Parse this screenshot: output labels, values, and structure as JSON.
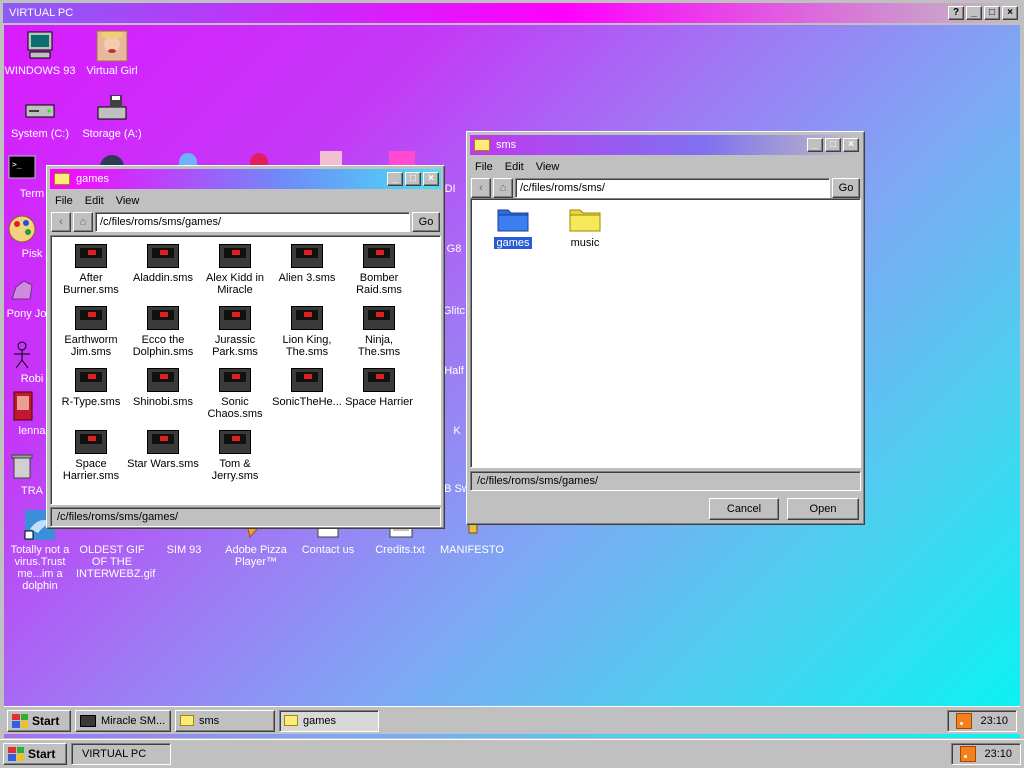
{
  "outer_window": {
    "title": "VIRTUAL PC",
    "buttons": [
      "?",
      "_",
      "□",
      "×"
    ]
  },
  "desktop_icons": [
    {
      "label": "WINDOWS 93",
      "icon": "computer-icon"
    },
    {
      "label": "Virtual Girl",
      "icon": "face-icon"
    },
    {
      "label": "System (C:)",
      "icon": "drive-icon"
    },
    {
      "label": "Storage (A:)",
      "icon": "floppy-drive-icon"
    },
    {
      "label": "Term",
      "icon": "terminal-icon"
    },
    {
      "label": "Pisk",
      "icon": "paint-icon"
    },
    {
      "label": "Pony Jock",
      "icon": "pony-icon"
    },
    {
      "label": "Robi",
      "icon": "robot-icon"
    },
    {
      "label": "lenna",
      "icon": "image-icon"
    },
    {
      "label": "TRA",
      "icon": "trash-icon"
    },
    {
      "label": "Totally not a virus.Trust me...im a dolphin",
      "icon": "dolphin-icon"
    },
    {
      "label": "OLDEST GIF OF THE INTERWEBZ.gif",
      "icon": "gif-icon"
    },
    {
      "label": "SIM 93",
      "icon": "sim-icon"
    },
    {
      "label": "Adobe Pizza Player™",
      "icon": "pizza-icon"
    },
    {
      "label": "Contact us",
      "icon": "contact-icon"
    },
    {
      "label": "Credits.txt",
      "icon": "text-file-icon"
    },
    {
      "label": "MANIFESTO",
      "icon": "manifesto-icon"
    },
    {
      "label": "MIDI",
      "icon": "midi-icon"
    },
    {
      "label": "G8",
      "icon": "app-icon"
    },
    {
      "label": "Glitc",
      "icon": "glitch-icon"
    },
    {
      "label": "Half",
      "icon": "app-icon"
    },
    {
      "label": "K",
      "icon": "app-icon"
    },
    {
      "label": "B Sw",
      "icon": "app-icon"
    }
  ],
  "games_window": {
    "title": "games",
    "menu": [
      "File",
      "Edit",
      "View"
    ],
    "address": "/c/files/roms/sms/games/",
    "go_label": "Go",
    "status": "/c/files/roms/sms/games/",
    "files": [
      "After Burner.sms",
      "Aladdin.sms",
      "Alex Kidd in Miracle",
      "Alien 3.sms",
      "Bomber Raid.sms",
      "Earthworm Jim.sms",
      "Ecco the Dolphin.sms",
      "Jurassic Park.sms",
      "Lion King, The.sms",
      "Ninja, The.sms",
      "R-Type.sms",
      "Shinobi.sms",
      "Sonic Chaos.sms",
      "SonicTheHe...",
      "Space Harrier",
      "Space Harrier.sms",
      "Star Wars.sms",
      "Tom & Jerry.sms"
    ]
  },
  "sms_window": {
    "title": "sms",
    "menu": [
      "File",
      "Edit",
      "View"
    ],
    "address": "/c/files/roms/sms/",
    "go_label": "Go",
    "folders": [
      {
        "label": "games",
        "selected": true,
        "color": "#2f6be0"
      },
      {
        "label": "music",
        "selected": false,
        "color": "#f5e85a"
      }
    ],
    "status": "/c/files/roms/sms/games/",
    "cancel_label": "Cancel",
    "open_label": "Open"
  },
  "inner_taskbar": {
    "start_label": "Start",
    "items": [
      "Miracle SM...",
      "sms",
      "games"
    ],
    "active_item": "games",
    "clock": "23:10"
  },
  "host_taskbar": {
    "start_label": "Start",
    "items": [
      "VIRTUAL PC"
    ],
    "clock": "23:10"
  },
  "colors": {
    "title_active": "#ff00ff",
    "title_inactive": "#8080ff",
    "selection": "#2a5bd7"
  }
}
